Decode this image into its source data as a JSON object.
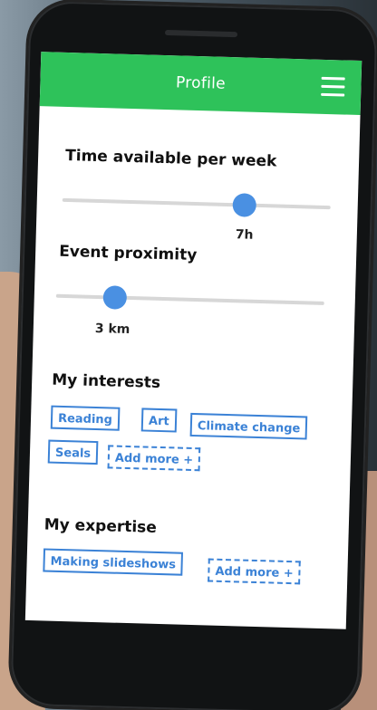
{
  "header": {
    "title": "Profile",
    "menu_icon": "hamburger-menu-icon"
  },
  "time_available": {
    "label": "Time available per week",
    "value_text": "7h",
    "fill_fraction": 0.68
  },
  "event_proximity": {
    "label": "Event proximity",
    "value_text": "3 km",
    "fill_fraction": 0.22
  },
  "interests": {
    "title": "My interests",
    "tags": [
      "Reading",
      "Art",
      "Climate change",
      "Seals"
    ],
    "add_label": "Add more +"
  },
  "expertise": {
    "title": "My expertise",
    "tags": [
      "Making slideshows"
    ],
    "add_label": "Add more +"
  },
  "colors": {
    "header_green": "#2ec25a",
    "accent_blue": "#3b82d6",
    "thumb_blue": "#4a90e2"
  }
}
